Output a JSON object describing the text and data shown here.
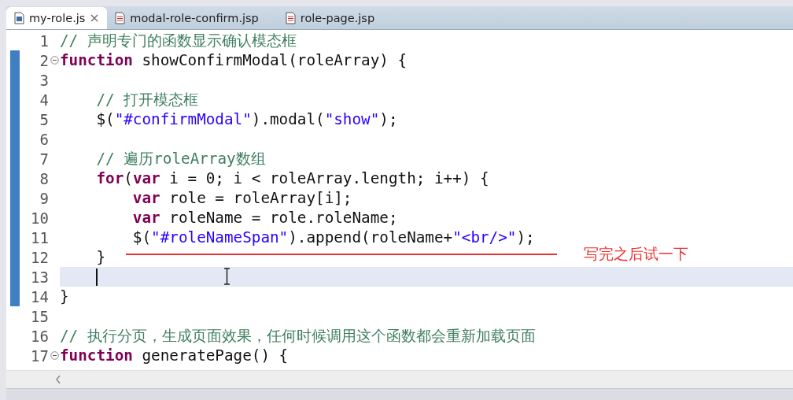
{
  "tabs": [
    {
      "label": "my-role.js",
      "selected": true,
      "kind": "js",
      "closable": true
    },
    {
      "label": "modal-role-confirm.jsp",
      "selected": false,
      "kind": "jsp",
      "closable": false
    },
    {
      "label": "role-page.jsp",
      "selected": false,
      "kind": "jsp",
      "closable": false
    }
  ],
  "lines": [
    {
      "number": "1",
      "foldable": false,
      "changed": false,
      "current": false,
      "tokens": [
        {
          "kind": "comment",
          "text": "// 声明专门的函数显示确认模态框"
        }
      ]
    },
    {
      "number": "2",
      "foldable": true,
      "changed": true,
      "current": false,
      "tokens": [
        {
          "kind": "keyword",
          "text": "function"
        },
        {
          "kind": "plain",
          "text": " showConfirmModal(roleArray) {"
        }
      ]
    },
    {
      "number": "3",
      "foldable": false,
      "changed": true,
      "current": false
    },
    {
      "number": "4",
      "foldable": false,
      "changed": true,
      "current": false,
      "tokens": [
        {
          "kind": "comment",
          "text": "    // 打开模态框"
        }
      ]
    },
    {
      "number": "5",
      "foldable": false,
      "changed": true,
      "current": false,
      "tokens": [
        {
          "kind": "plain",
          "text": "    $("
        },
        {
          "kind": "string",
          "text": "\"#confirmModal\""
        },
        {
          "kind": "plain",
          "text": ").modal("
        },
        {
          "kind": "string",
          "text": "\"show\""
        },
        {
          "kind": "plain",
          "text": ");"
        }
      ]
    },
    {
      "number": "6",
      "foldable": false,
      "changed": true,
      "current": false
    },
    {
      "number": "7",
      "foldable": false,
      "changed": true,
      "current": false,
      "tokens": [
        {
          "kind": "comment",
          "text": "    // 遍历roleArray数组"
        }
      ]
    },
    {
      "number": "8",
      "foldable": false,
      "changed": true,
      "current": false,
      "tokens": [
        {
          "kind": "keyword",
          "text": "    for"
        },
        {
          "kind": "plain",
          "text": "("
        },
        {
          "kind": "keyword",
          "text": "var"
        },
        {
          "kind": "plain",
          "text": " i = 0; i < roleArray.length; i++) {"
        }
      ]
    },
    {
      "number": "9",
      "foldable": false,
      "changed": true,
      "current": false,
      "tokens": [
        {
          "kind": "keyword",
          "text": "        var"
        },
        {
          "kind": "plain",
          "text": " role = roleArray[i];"
        }
      ]
    },
    {
      "number": "10",
      "foldable": false,
      "changed": true,
      "current": false,
      "tokens": [
        {
          "kind": "keyword",
          "text": "        var"
        },
        {
          "kind": "plain",
          "text": " roleName = role.roleName;"
        }
      ]
    },
    {
      "number": "11",
      "foldable": false,
      "changed": true,
      "current": false,
      "tokens": [
        {
          "kind": "plain",
          "text": "        $("
        },
        {
          "kind": "string",
          "text": "\"#roleNameSpan\""
        },
        {
          "kind": "plain",
          "text": ").append(roleName+"
        },
        {
          "kind": "string",
          "text": "\"<br/>\""
        },
        {
          "kind": "plain",
          "text": ");"
        }
      ]
    },
    {
      "number": "12",
      "foldable": false,
      "changed": true,
      "current": false,
      "tokens": [
        {
          "kind": "plain",
          "text": "    }"
        }
      ]
    },
    {
      "number": "13",
      "foldable": false,
      "changed": true,
      "current": true
    },
    {
      "number": "14",
      "foldable": false,
      "changed": true,
      "current": false,
      "tokens": [
        {
          "kind": "plain",
          "text": "}"
        }
      ]
    },
    {
      "number": "15",
      "foldable": false,
      "changed": false,
      "current": false
    },
    {
      "number": "16",
      "foldable": false,
      "changed": false,
      "current": false,
      "tokens": [
        {
          "kind": "comment",
          "text": "// 执行分页，生成页面效果，任何时候调用这个函数都会重新加载页面"
        }
      ]
    },
    {
      "number": "17",
      "foldable": true,
      "changed": false,
      "current": false,
      "tokens": [
        {
          "kind": "keyword",
          "text": "function"
        },
        {
          "kind": "plain",
          "text": " generatePage() {"
        }
      ]
    }
  ],
  "annotation": {
    "text": "写完之后试一下"
  }
}
